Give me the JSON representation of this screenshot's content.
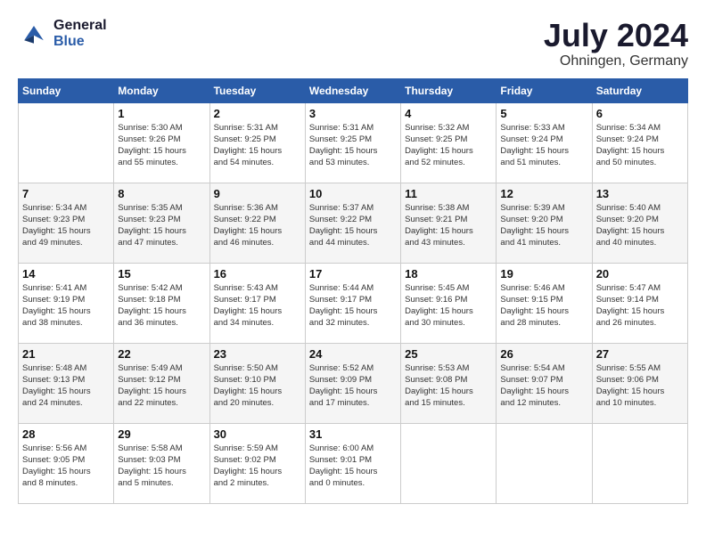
{
  "header": {
    "logo_line1": "General",
    "logo_line2": "Blue",
    "month": "July 2024",
    "location": "Ohningen, Germany"
  },
  "days_of_week": [
    "Sunday",
    "Monday",
    "Tuesday",
    "Wednesday",
    "Thursday",
    "Friday",
    "Saturday"
  ],
  "weeks": [
    [
      {
        "day": "",
        "info": ""
      },
      {
        "day": "1",
        "info": "Sunrise: 5:30 AM\nSunset: 9:26 PM\nDaylight: 15 hours\nand 55 minutes."
      },
      {
        "day": "2",
        "info": "Sunrise: 5:31 AM\nSunset: 9:25 PM\nDaylight: 15 hours\nand 54 minutes."
      },
      {
        "day": "3",
        "info": "Sunrise: 5:31 AM\nSunset: 9:25 PM\nDaylight: 15 hours\nand 53 minutes."
      },
      {
        "day": "4",
        "info": "Sunrise: 5:32 AM\nSunset: 9:25 PM\nDaylight: 15 hours\nand 52 minutes."
      },
      {
        "day": "5",
        "info": "Sunrise: 5:33 AM\nSunset: 9:24 PM\nDaylight: 15 hours\nand 51 minutes."
      },
      {
        "day": "6",
        "info": "Sunrise: 5:34 AM\nSunset: 9:24 PM\nDaylight: 15 hours\nand 50 minutes."
      }
    ],
    [
      {
        "day": "7",
        "info": "Sunrise: 5:34 AM\nSunset: 9:23 PM\nDaylight: 15 hours\nand 49 minutes."
      },
      {
        "day": "8",
        "info": "Sunrise: 5:35 AM\nSunset: 9:23 PM\nDaylight: 15 hours\nand 47 minutes."
      },
      {
        "day": "9",
        "info": "Sunrise: 5:36 AM\nSunset: 9:22 PM\nDaylight: 15 hours\nand 46 minutes."
      },
      {
        "day": "10",
        "info": "Sunrise: 5:37 AM\nSunset: 9:22 PM\nDaylight: 15 hours\nand 44 minutes."
      },
      {
        "day": "11",
        "info": "Sunrise: 5:38 AM\nSunset: 9:21 PM\nDaylight: 15 hours\nand 43 minutes."
      },
      {
        "day": "12",
        "info": "Sunrise: 5:39 AM\nSunset: 9:20 PM\nDaylight: 15 hours\nand 41 minutes."
      },
      {
        "day": "13",
        "info": "Sunrise: 5:40 AM\nSunset: 9:20 PM\nDaylight: 15 hours\nand 40 minutes."
      }
    ],
    [
      {
        "day": "14",
        "info": "Sunrise: 5:41 AM\nSunset: 9:19 PM\nDaylight: 15 hours\nand 38 minutes."
      },
      {
        "day": "15",
        "info": "Sunrise: 5:42 AM\nSunset: 9:18 PM\nDaylight: 15 hours\nand 36 minutes."
      },
      {
        "day": "16",
        "info": "Sunrise: 5:43 AM\nSunset: 9:17 PM\nDaylight: 15 hours\nand 34 minutes."
      },
      {
        "day": "17",
        "info": "Sunrise: 5:44 AM\nSunset: 9:17 PM\nDaylight: 15 hours\nand 32 minutes."
      },
      {
        "day": "18",
        "info": "Sunrise: 5:45 AM\nSunset: 9:16 PM\nDaylight: 15 hours\nand 30 minutes."
      },
      {
        "day": "19",
        "info": "Sunrise: 5:46 AM\nSunset: 9:15 PM\nDaylight: 15 hours\nand 28 minutes."
      },
      {
        "day": "20",
        "info": "Sunrise: 5:47 AM\nSunset: 9:14 PM\nDaylight: 15 hours\nand 26 minutes."
      }
    ],
    [
      {
        "day": "21",
        "info": "Sunrise: 5:48 AM\nSunset: 9:13 PM\nDaylight: 15 hours\nand 24 minutes."
      },
      {
        "day": "22",
        "info": "Sunrise: 5:49 AM\nSunset: 9:12 PM\nDaylight: 15 hours\nand 22 minutes."
      },
      {
        "day": "23",
        "info": "Sunrise: 5:50 AM\nSunset: 9:10 PM\nDaylight: 15 hours\nand 20 minutes."
      },
      {
        "day": "24",
        "info": "Sunrise: 5:52 AM\nSunset: 9:09 PM\nDaylight: 15 hours\nand 17 minutes."
      },
      {
        "day": "25",
        "info": "Sunrise: 5:53 AM\nSunset: 9:08 PM\nDaylight: 15 hours\nand 15 minutes."
      },
      {
        "day": "26",
        "info": "Sunrise: 5:54 AM\nSunset: 9:07 PM\nDaylight: 15 hours\nand 12 minutes."
      },
      {
        "day": "27",
        "info": "Sunrise: 5:55 AM\nSunset: 9:06 PM\nDaylight: 15 hours\nand 10 minutes."
      }
    ],
    [
      {
        "day": "28",
        "info": "Sunrise: 5:56 AM\nSunset: 9:05 PM\nDaylight: 15 hours\nand 8 minutes."
      },
      {
        "day": "29",
        "info": "Sunrise: 5:58 AM\nSunset: 9:03 PM\nDaylight: 15 hours\nand 5 minutes."
      },
      {
        "day": "30",
        "info": "Sunrise: 5:59 AM\nSunset: 9:02 PM\nDaylight: 15 hours\nand 2 minutes."
      },
      {
        "day": "31",
        "info": "Sunrise: 6:00 AM\nSunset: 9:01 PM\nDaylight: 15 hours\nand 0 minutes."
      },
      {
        "day": "",
        "info": ""
      },
      {
        "day": "",
        "info": ""
      },
      {
        "day": "",
        "info": ""
      }
    ]
  ]
}
